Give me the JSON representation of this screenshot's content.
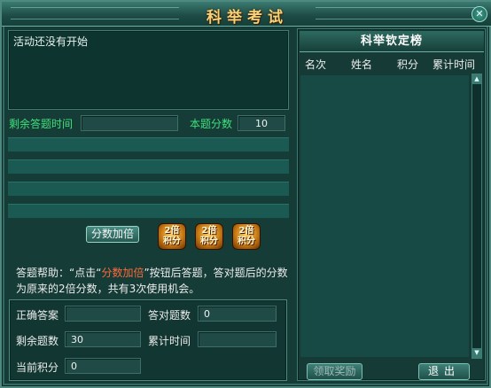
{
  "window": {
    "title": "科举考试",
    "close_icon": "close-icon"
  },
  "message": {
    "text": "活动还没有开始"
  },
  "answer_info": {
    "time_label": "剩余答题时间",
    "time_value": "",
    "score_label": "本题分数",
    "score_value": "10"
  },
  "answers": [
    "",
    "",
    "",
    ""
  ],
  "bonus": {
    "button_label": "分数加倍",
    "tokens": [
      {
        "line1": "2倍",
        "line2": "积分"
      },
      {
        "line1": "2倍",
        "line2": "积分"
      },
      {
        "line1": "2倍",
        "line2": "积分"
      }
    ]
  },
  "help": {
    "prefix": "答题帮助：“点击“",
    "highlight": "分数加倍",
    "suffix": "”按钮后答题，答对题后的分数为原来的2倍分数，共有3次使用机会。"
  },
  "stats": {
    "correct_label": "正确答案",
    "correct_value": "",
    "answered_label": "答对题数",
    "answered_value": "0",
    "remaining_label": "剩余题数",
    "remaining_value": "30",
    "total_time_label": "累计时间",
    "total_time_value": "",
    "current_score_label": "当前积分",
    "current_score_value": "0"
  },
  "ranking": {
    "title": "科举钦定榜",
    "columns": [
      "名次",
      "姓名",
      "积分",
      "累计时间"
    ],
    "rows": [],
    "claim_label": "领取奖励",
    "exit_label": "退出"
  },
  "colors": {
    "accent_green": "#3fe07a",
    "title_gold": "#f5d27a",
    "highlight_red": "#ff6a3a"
  }
}
